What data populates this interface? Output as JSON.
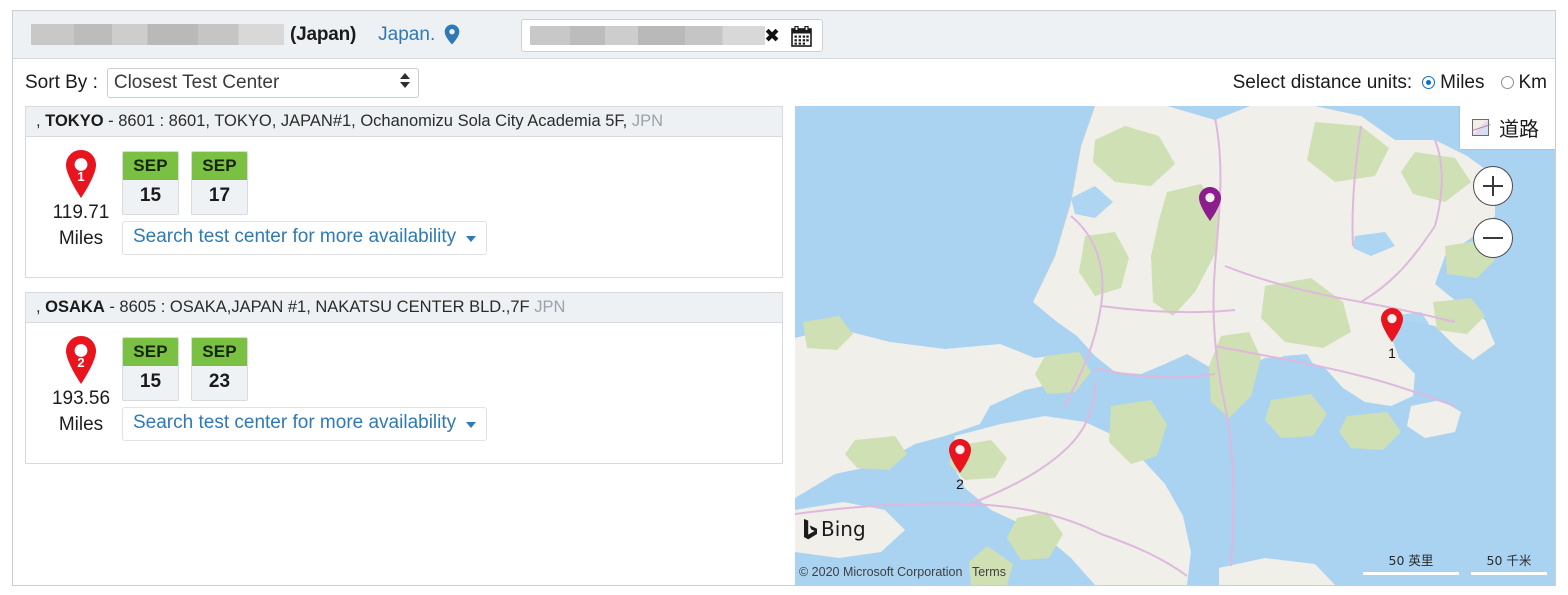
{
  "topbar": {
    "candidate_name_redacted": true,
    "country_label": "(Japan)",
    "region_link": "Japan.",
    "location_pin_icon": "map-pin-icon",
    "search_value_redacted": true,
    "search_placeholder": "",
    "clear_icon": "close-x-icon",
    "calendar_icon": "calendar-icon"
  },
  "sortbar": {
    "label": "Sort By :",
    "selected_option": "Closest Test Center",
    "options": [
      "Closest Test Center"
    ],
    "units_label": "Select distance units:",
    "units": [
      {
        "label": "Miles",
        "selected": true
      },
      {
        "label": "Km",
        "selected": false
      }
    ]
  },
  "results": [
    {
      "prefix": ", ",
      "city": "TOKYO",
      "details": " - 8601 : 8601, TOKYO, JAPAN#1, Ochanomizu Sola City Academia 5F,",
      "country_code": " JPN",
      "pin_number": "1",
      "distance": "119.71",
      "distance_unit": "Miles",
      "dates": [
        {
          "month": "SEP",
          "day": "15"
        },
        {
          "month": "SEP",
          "day": "17"
        }
      ],
      "more_link": "Search test center for more availability"
    },
    {
      "prefix": ", ",
      "city": "OSAKA",
      "details": " - 8605 : OSAKA,JAPAN #1, NAKATSU CENTER BLD.,7F",
      "country_code": " JPN",
      "pin_number": "2",
      "distance": "193.56",
      "distance_unit": "Miles",
      "dates": [
        {
          "month": "SEP",
          "day": "15"
        },
        {
          "month": "SEP",
          "day": "23"
        }
      ],
      "more_link": "Search test center for more availability"
    }
  ],
  "map": {
    "maptype_label": "道路",
    "maptype_icon": "map-thumbnail-icon",
    "zoom_in_icon": "plus-icon",
    "zoom_out_icon": "minus-icon",
    "brand": "Bing",
    "copyright": "© 2020 Microsoft Corporation",
    "terms": "Terms",
    "scale_miles": "50 英里",
    "scale_km": "50 千米",
    "pins": [
      {
        "label": "1",
        "color": "#e8141e",
        "type": "result"
      },
      {
        "label": "2",
        "color": "#e8141e",
        "type": "result"
      },
      {
        "label": "",
        "color": "#8c1d8c",
        "type": "home"
      }
    ],
    "colors": {
      "water": "#aad3f2",
      "land": "#f1efe9",
      "forest": "#cfe0b4",
      "road": "#dfb8dd"
    }
  }
}
